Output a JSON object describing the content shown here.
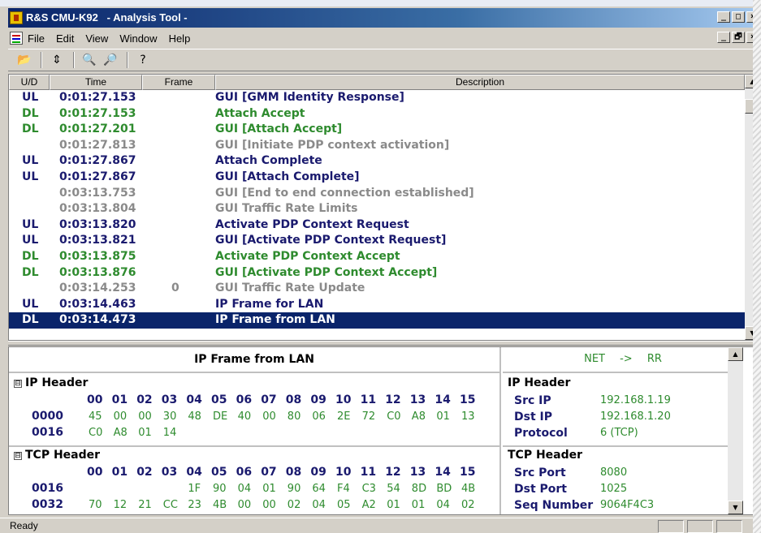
{
  "window": {
    "title": "R&S CMU-K92   - Analysis Tool -",
    "caption_buttons": [
      "_",
      "□",
      "×"
    ],
    "mdi_buttons": [
      "_",
      "🗗",
      "×"
    ]
  },
  "menu": [
    "File",
    "Edit",
    "View",
    "Window",
    "Help"
  ],
  "toolbar": [
    {
      "icon": "open-folder-icon",
      "glyph": "📂"
    },
    {
      "icon": "split-view-icon",
      "glyph": "⇕"
    },
    {
      "icon": "find-icon",
      "glyph": "🔍"
    },
    {
      "icon": "find-next-icon",
      "glyph": "🔎"
    },
    {
      "icon": "help-icon",
      "glyph": "?"
    }
  ],
  "log": {
    "columns": [
      "U/D",
      "Time",
      "Frame",
      "Description"
    ],
    "rows": [
      {
        "ud": "UL",
        "time": "0:01:27.153",
        "frame": "",
        "desc": "GUI [GMM Identity Response]",
        "kind": "ul"
      },
      {
        "ud": "DL",
        "time": "0:01:27.153",
        "frame": "",
        "desc": "Attach Accept",
        "kind": "dl"
      },
      {
        "ud": "DL",
        "time": "0:01:27.201",
        "frame": "",
        "desc": "GUI [Attach Accept]",
        "kind": "dl"
      },
      {
        "ud": "",
        "time": "0:01:27.813",
        "frame": "",
        "desc": "GUI [Initiate PDP context activation]",
        "kind": "gui"
      },
      {
        "ud": "UL",
        "time": "0:01:27.867",
        "frame": "",
        "desc": "Attach Complete",
        "kind": "ul"
      },
      {
        "ud": "UL",
        "time": "0:01:27.867",
        "frame": "",
        "desc": "GUI [Attach Complete]",
        "kind": "ul"
      },
      {
        "ud": "",
        "time": "0:03:13.753",
        "frame": "",
        "desc": "GUI [End to end connection established]",
        "kind": "gui"
      },
      {
        "ud": "",
        "time": "0:03:13.804",
        "frame": "",
        "desc": "GUI Traffic Rate Limits",
        "kind": "gui"
      },
      {
        "ud": "UL",
        "time": "0:03:13.820",
        "frame": "",
        "desc": "Activate PDP Context Request",
        "kind": "ul"
      },
      {
        "ud": "UL",
        "time": "0:03:13.821",
        "frame": "",
        "desc": "GUI [Activate PDP Context Request]",
        "kind": "ul"
      },
      {
        "ud": "DL",
        "time": "0:03:13.875",
        "frame": "",
        "desc": "Activate PDP Context Accept",
        "kind": "dl"
      },
      {
        "ud": "DL",
        "time": "0:03:13.876",
        "frame": "",
        "desc": "GUI [Activate PDP Context Accept]",
        "kind": "dl"
      },
      {
        "ud": "",
        "time": "0:03:14.253",
        "frame": "0",
        "desc": "GUI Traffic Rate Update",
        "kind": "gui"
      },
      {
        "ud": "UL",
        "time": "0:03:14.463",
        "frame": "",
        "desc": "IP Frame for LAN",
        "kind": "ul"
      },
      {
        "ud": "DL",
        "time": "0:03:14.473",
        "frame": "",
        "desc": "IP Frame from LAN",
        "kind": "sel"
      }
    ]
  },
  "hex": {
    "title": "IP Frame from LAN",
    "sections": [
      {
        "name": "IP Header",
        "expander": "⊟",
        "columns": [
          "00",
          "01",
          "02",
          "03",
          "04",
          "05",
          "06",
          "07",
          "08",
          "09",
          "10",
          "11",
          "12",
          "13",
          "14",
          "15"
        ],
        "rows": [
          {
            "addr": "0000",
            "bytes": [
              "45",
              "00",
              "00",
              "30",
              "48",
              "DE",
              "40",
              "00",
              "80",
              "06",
              "2E",
              "72",
              "C0",
              "A8",
              "01",
              "13"
            ]
          },
          {
            "addr": "0016",
            "bytes": [
              "C0",
              "A8",
              "01",
              "14",
              "",
              "",
              "",
              "",
              "",
              "",
              "",
              "",
              "",
              "",
              "",
              ""
            ]
          }
        ]
      },
      {
        "name": "TCP Header",
        "expander": "⊟",
        "columns": [
          "00",
          "01",
          "02",
          "03",
          "04",
          "05",
          "06",
          "07",
          "08",
          "09",
          "10",
          "11",
          "12",
          "13",
          "14",
          "15"
        ],
        "rows": [
          {
            "addr": "0016",
            "bytes": [
              "",
              "",
              "",
              "",
              "1F",
              "90",
              "04",
              "01",
              "90",
              "64",
              "F4",
              "C3",
              "54",
              "8D",
              "BD",
              "4B"
            ]
          },
          {
            "addr": "0032",
            "bytes": [
              "70",
              "12",
              "21",
              "CC",
              "23",
              "4B",
              "00",
              "00",
              "02",
              "04",
              "05",
              "A2",
              "01",
              "01",
              "04",
              "02"
            ]
          }
        ]
      }
    ]
  },
  "info": {
    "direction": "NET -> RR",
    "sections": [
      {
        "name": "IP Header",
        "fields": [
          {
            "k": "Src IP",
            "v": "192.168.1.19"
          },
          {
            "k": "Dst IP",
            "v": "192.168.1.20"
          },
          {
            "k": "Protocol",
            "v": "6 (TCP)"
          }
        ]
      },
      {
        "name": "TCP Header",
        "fields": [
          {
            "k": "Src Port",
            "v": "8080"
          },
          {
            "k": "Dst Port",
            "v": "1025"
          },
          {
            "k": "Seq Number",
            "v": "9064F4C3"
          }
        ]
      }
    ]
  },
  "status": {
    "text": "Ready"
  },
  "colors": {
    "ul": "#1a1a6e",
    "dl": "#2e8b2e",
    "gui": "#8a8a8a",
    "selection": "#0a246a"
  }
}
